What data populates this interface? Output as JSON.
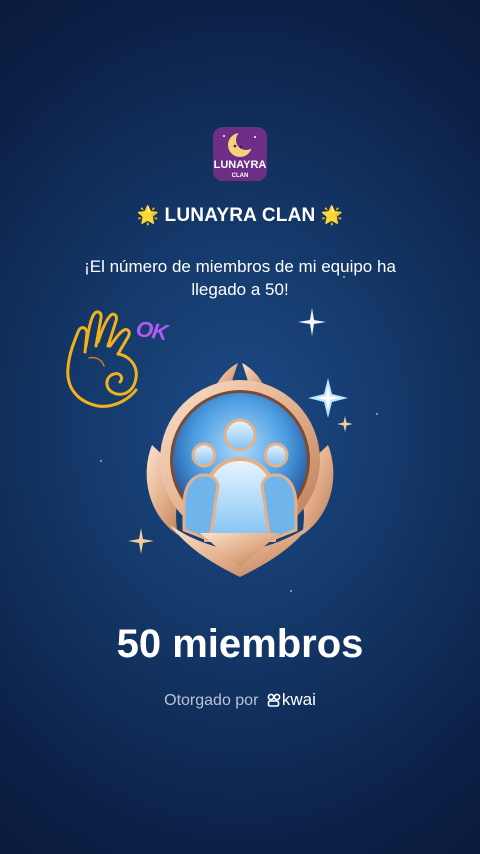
{
  "logo": {
    "text_line1": "LUNAYRA",
    "text_line2": "CLAN",
    "icon": "moon-icon"
  },
  "header": {
    "star_left": "🌟",
    "clan_name": "LUNAYRA CLAN",
    "star_right": "🌟"
  },
  "message": "¡El número de miembros de mi equipo ha llegado a 50!",
  "sticker": {
    "ok_text": "OK",
    "icon": "ok-hand-icon"
  },
  "badge": {
    "icon": "members-badge-icon"
  },
  "achievement": {
    "count_text": "50 miembros"
  },
  "footer": {
    "awarded_by": "Otorgado por",
    "brand": "kwai"
  },
  "colors": {
    "background_top": "#0a1c3d",
    "background_center": "#1d4b86",
    "badge_gold": "#e3b08c",
    "badge_blue": "#4b9be0",
    "logo_purple": "#6d2f86",
    "ok_purple": "#b25af0",
    "hand_yellow": "#f2b21a"
  }
}
